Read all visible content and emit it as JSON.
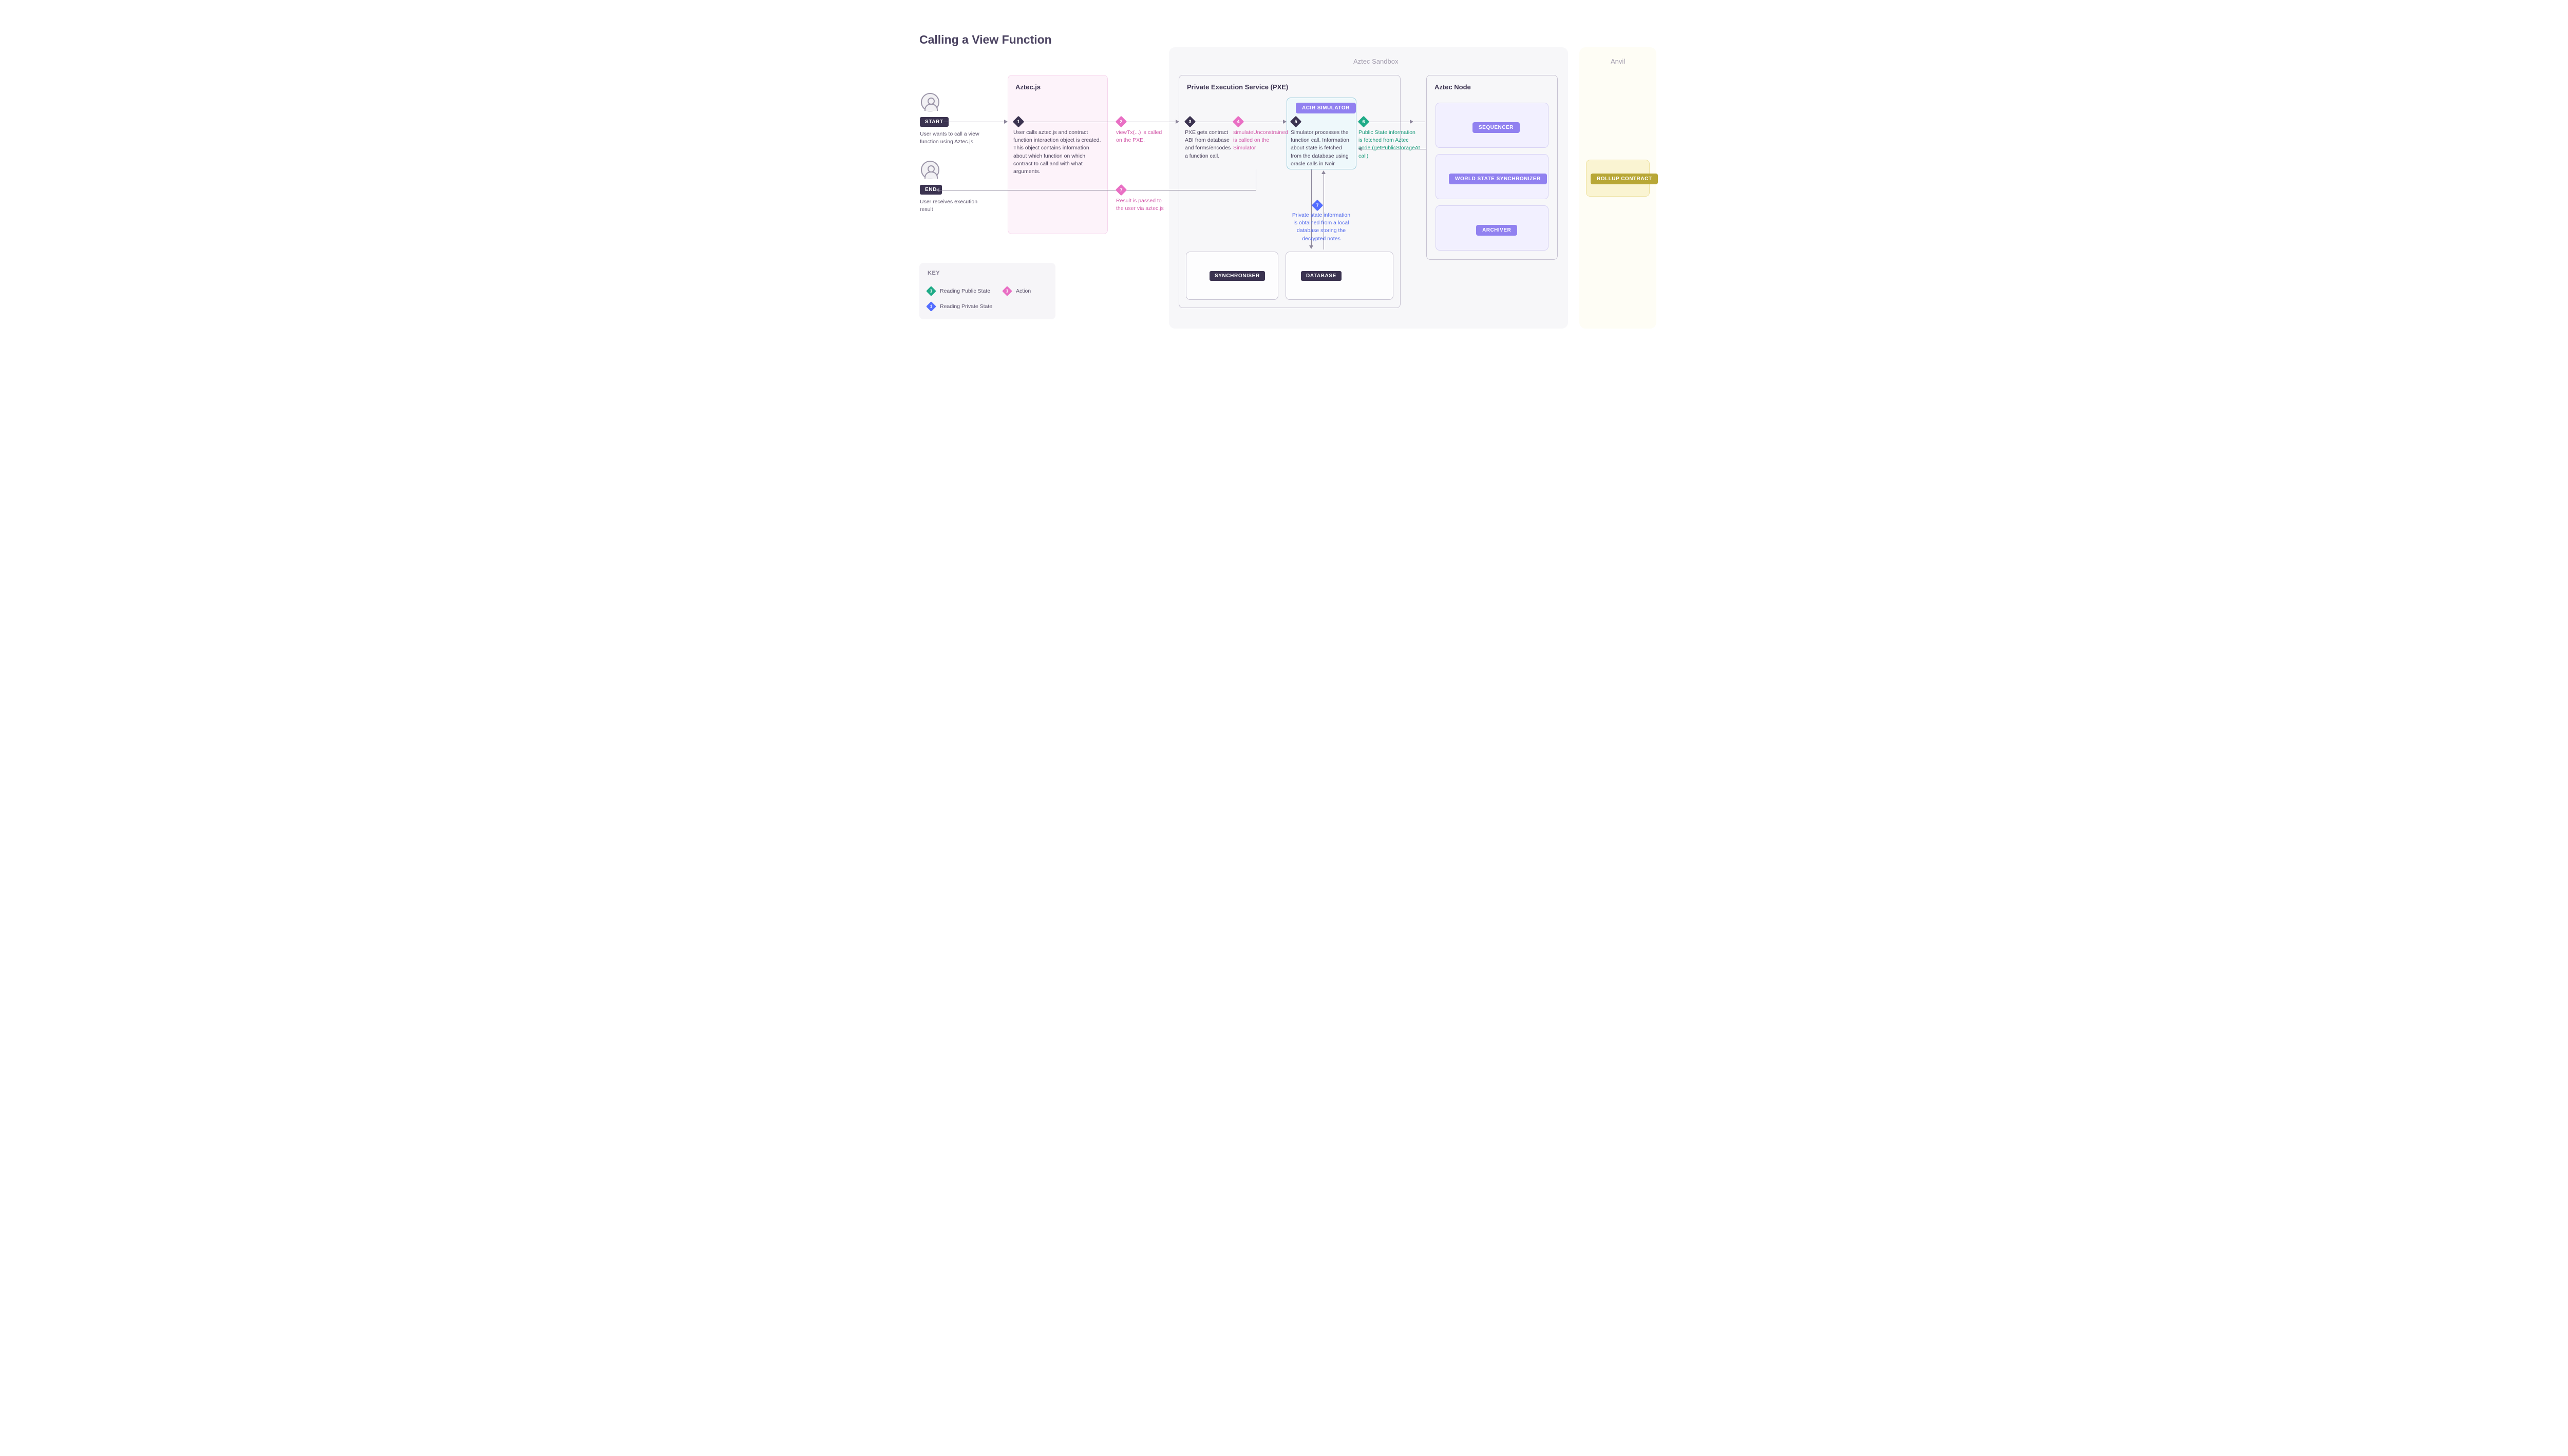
{
  "title": "Calling a View Function",
  "sandbox_label": "Aztec Sandbox",
  "anvil_label": "Anvil",
  "groups": {
    "aztecjs": "Aztec.js",
    "pxe": "Private Execution Service (PXE)",
    "node": "Aztec Node"
  },
  "start": {
    "label": "START",
    "caption": "User wants to call a view function using Aztec.js"
  },
  "end": {
    "label": "END",
    "caption": "User receives execution result"
  },
  "steps": {
    "s1": {
      "num": "1",
      "text": "User calls aztec.js and contract function interaction object is created. This object contains information about which function on which contract to call and with what arguments."
    },
    "s2": {
      "num": "2",
      "text": "viewTx(...) is called on the PXE."
    },
    "s3": {
      "num": "3",
      "text": "PXE gets contract ABI from database and forms/encodes a function call."
    },
    "s4": {
      "num": "4",
      "text": "simulateUnconstrained is called on the Simulator"
    },
    "s5": {
      "num": "5",
      "text": "Simulator processes the function call. Information about state is fetched from the database using oracle calls in Noir"
    },
    "s6": {
      "num": "6",
      "text": "Public State information is fetched from Aztec node (getPublicStorageAt call)"
    },
    "s7": {
      "num": "7",
      "text": "Private state information is obtained from a local database storing the decrypted notes"
    },
    "s8": {
      "num": "7",
      "text": "Result is passed to the user via aztec.js"
    }
  },
  "badges": {
    "acir": "ACIR SIMULATOR",
    "synchroniser": "SYNCHRONISER",
    "database": "DATABASE",
    "sequencer": "SEQUENCER",
    "wss": "WORLD STATE SYNCHRONIZER",
    "archiver": "ARCHIVER",
    "rollup": "ROLLUP CONTRACT"
  },
  "key": {
    "title": "KEY",
    "public": "Reading Public State",
    "private": "Reading Private State",
    "action": "Action"
  }
}
